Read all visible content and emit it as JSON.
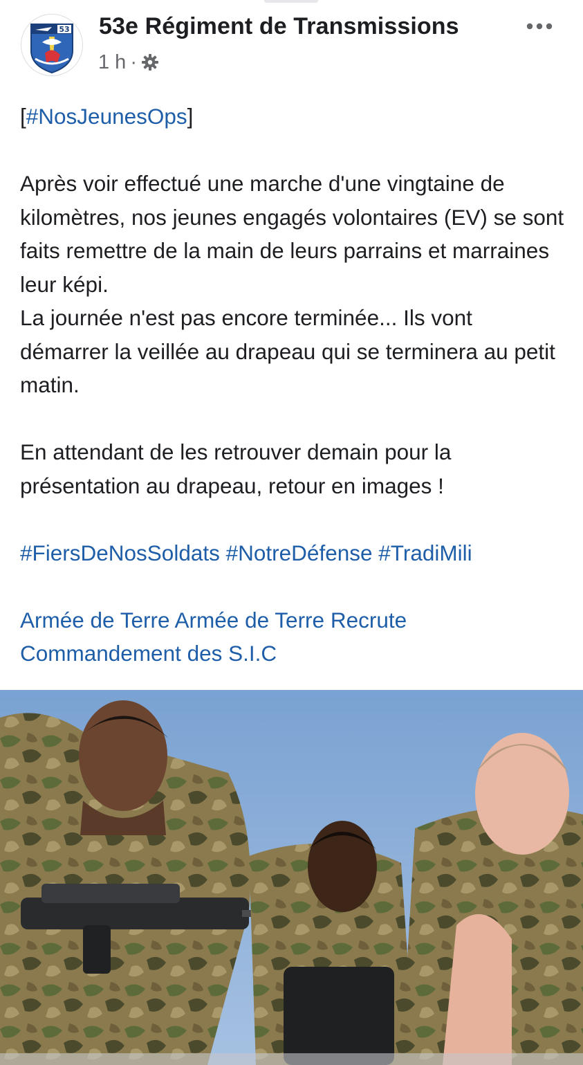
{
  "post": {
    "page_name": "53e Régiment de Transmissions",
    "time": "1 h",
    "separator": "·",
    "privacy_icon": "settings-gear-icon",
    "more_icon": "more-horizontal-icon",
    "avatar_badge": "53",
    "text": {
      "tag_open": "[",
      "tag": "#NosJeunesOps",
      "tag_close": "]",
      "para1": "Après voir effectué une marche d'une vingtaine de kilomètres, nos jeunes engagés volontaires (EV) se sont faits remettre de la main de leurs parrains et marraines leur képi.",
      "para2": "La journée n'est pas encore terminée... Ils vont démarrer la veillée au drapeau qui se terminera au petit matin.",
      "para3": "En attendant de les retrouver demain pour la présentation au drapeau, retour en images !",
      "hashtags": [
        "#FiersDeNosSoldats",
        "#NotreDéfense",
        "#TradiMili"
      ],
      "mentions": [
        "Armée de Terre",
        "Armée de Terre Recrute",
        "Commandement des S.I.C"
      ]
    },
    "photo_icon": "photo-soldats-icon"
  },
  "colors": {
    "link": "#1e5ea8",
    "text": "#1c1e21",
    "meta": "#65676b",
    "sky": "#7fa6d4"
  }
}
